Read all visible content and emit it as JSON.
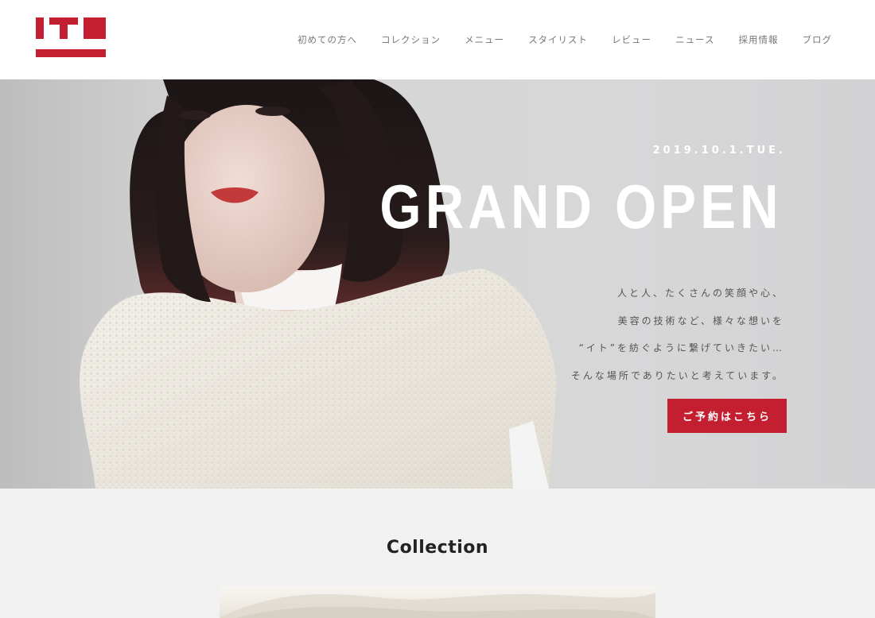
{
  "header": {
    "logo": {
      "text": "ITO",
      "color": "#c41f30"
    },
    "nav": [
      {
        "label": "初めての方へ"
      },
      {
        "label": "コレクション"
      },
      {
        "label": "メニュー"
      },
      {
        "label": "スタイリスト"
      },
      {
        "label": "レビュー"
      },
      {
        "label": "ニュース"
      },
      {
        "label": "採用情報"
      },
      {
        "label": "ブログ"
      }
    ]
  },
  "hero": {
    "date": "2019.10.1.TUE.",
    "title": "GRAND OPEN",
    "copy": [
      "人と人、たくさんの笑顔や心、",
      "美容の技術など、様々な想いを",
      "“イト”を紡ぐように繋げていきたい…",
      "そんな場所でありたいと考えています。"
    ],
    "cta_label": "ご予約はこちら",
    "accent_color": "#c41f30"
  },
  "collection": {
    "title": "Collection"
  }
}
